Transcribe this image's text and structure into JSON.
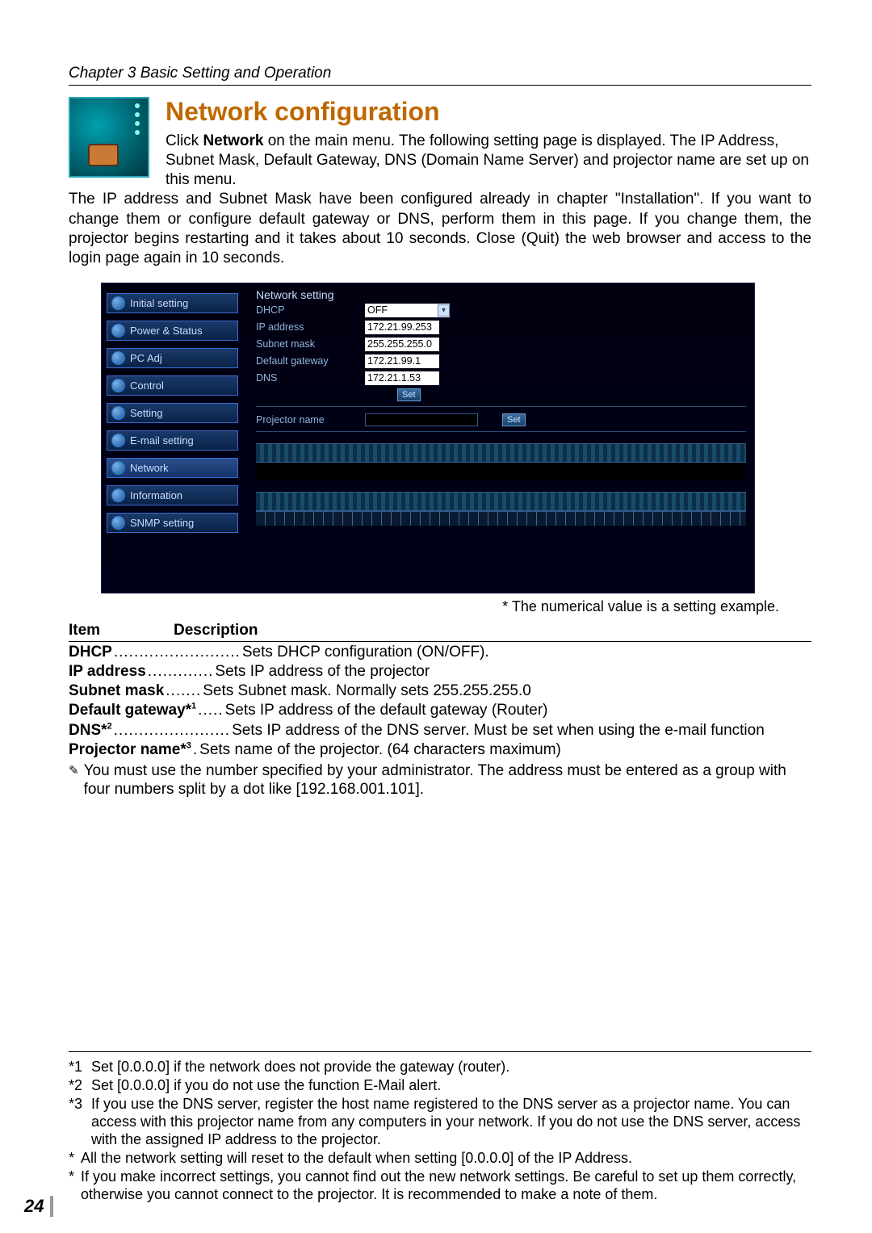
{
  "chapter": "Chapter 3 Basic Setting and Operation",
  "heading": "Network configuration",
  "intro": {
    "p1a": "Click ",
    "p1b": "Network",
    "p1c": " on the main menu. The following setting page is displayed. The IP Address, Subnet Mask, Default Gateway, DNS (Domain Name Server) and projector name are set up on this menu."
  },
  "body": "The IP address and Subnet Mask have been configured already in chapter \"Installation\". If you want to change them or configure default gateway or DNS, perform them in this page. If you change them, the projector begins restarting and it takes about 10 seconds. Close (Quit) the web browser and access to the login page again in 10 seconds.",
  "ui": {
    "sidebar": [
      "Initial setting",
      "Power & Status",
      "PC Adj",
      "Control",
      "Setting",
      "E-mail setting",
      "Network",
      "Information",
      "SNMP setting"
    ],
    "panel_title": "Network setting",
    "labels": {
      "dhcp": "DHCP",
      "ip": "IP address",
      "subnet": "Subnet mask",
      "gw": "Default gateway",
      "dns": "DNS",
      "pname": "Projector name"
    },
    "values": {
      "dhcp": "OFF",
      "ip": "172.21.99.253",
      "subnet": "255.255.255.0",
      "gw": "172.21.99.1",
      "dns": "172.21.1.53"
    },
    "set_btn": "Set"
  },
  "caption": "* The numerical value is a setting example.",
  "desc": {
    "head_item": "Item",
    "head_desc": "Description",
    "rows": [
      {
        "item": "DHCP",
        "dots": ".........................",
        "desc": "Sets DHCP configuration (ON/OFF)."
      },
      {
        "item": "IP address",
        "dots": ".............",
        "desc": "Sets IP address of the projector"
      },
      {
        "item": "Subnet mask",
        "dots": ".......",
        "desc": "Sets Subnet mask. Normally sets 255.255.255.0"
      },
      {
        "item": "Default gateway*",
        "sup": "1",
        "dots": ".....",
        "desc": "Sets IP address of the default gateway (Router)"
      },
      {
        "item": "DNS*",
        "sup": "2",
        "dots": ".......................",
        "desc": "Sets IP address of the DNS server. Must be set when using the e-mail function"
      },
      {
        "item": "Projector name*",
        "sup": "3",
        "dots": ".",
        "desc": "Sets name of the projector. (64 characters maximum)"
      }
    ],
    "note": "You must use the number specified by your administrator. The address must be entered as a group with four numbers split by a dot like [192.168.001.101]."
  },
  "footnotes": [
    {
      "mark": "*1",
      "text": "Set [0.0.0.0] if the network does not provide the gateway (router)."
    },
    {
      "mark": "*2",
      "text": "Set [0.0.0.0] if you do not use the function E-Mail alert."
    },
    {
      "mark": "*3",
      "text": "If you use the DNS server, register the host name registered to the DNS server as a projector name. You can access with this projector name from any computers in your network. If you do not use the DNS server, access with the assigned IP address to the projector."
    },
    {
      "mark": "*",
      "text": "All the network setting will reset to the default when setting [0.0.0.0] of the IP Address."
    },
    {
      "mark": "*",
      "text": "If you make incorrect settings, you cannot find out the new network settings. Be careful to set up them correctly, otherwise you cannot connect to the projector. It is recommended to make a note of them."
    }
  ],
  "page_number": "24"
}
